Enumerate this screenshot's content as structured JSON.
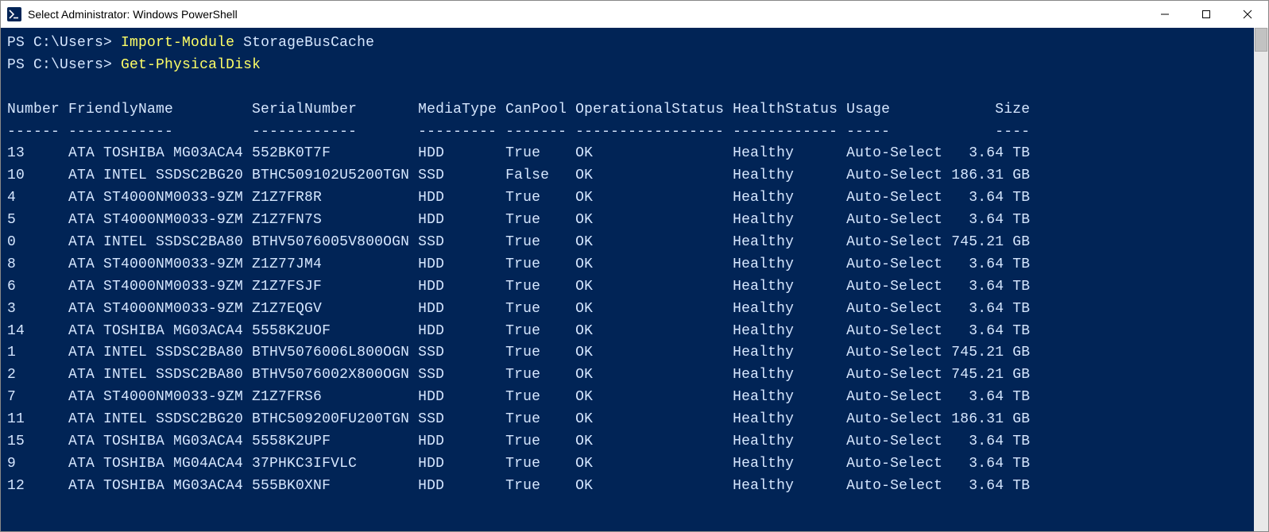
{
  "window": {
    "title": "Select Administrator: Windows PowerShell"
  },
  "terminal": {
    "prompt": "PS C:\\Users>",
    "commands": [
      {
        "cmd": "Import-Module",
        "arg": "StorageBusCache"
      },
      {
        "cmd": "Get-PhysicalDisk",
        "arg": ""
      }
    ],
    "headers": [
      "Number",
      "FriendlyName",
      "SerialNumber",
      "MediaType",
      "CanPool",
      "OperationalStatus",
      "HealthStatus",
      "Usage",
      "Size"
    ],
    "dashes": [
      "------",
      "------------",
      "------------",
      "---------",
      "-------",
      "-----------------",
      "------------",
      "-----",
      "----"
    ],
    "disks": [
      {
        "Number": "13",
        "FriendlyName": "ATA TOSHIBA MG03ACA4",
        "SerialNumber": "552BK0T7F",
        "MediaType": "HDD",
        "CanPool": "True",
        "OperationalStatus": "OK",
        "HealthStatus": "Healthy",
        "Usage": "Auto-Select",
        "Size": "3.64 TB"
      },
      {
        "Number": "10",
        "FriendlyName": "ATA INTEL SSDSC2BG20",
        "SerialNumber": "BTHC509102U5200TGN",
        "MediaType": "SSD",
        "CanPool": "False",
        "OperationalStatus": "OK",
        "HealthStatus": "Healthy",
        "Usage": "Auto-Select",
        "Size": "186.31 GB"
      },
      {
        "Number": "4",
        "FriendlyName": "ATA ST4000NM0033-9ZM",
        "SerialNumber": "Z1Z7FR8R",
        "MediaType": "HDD",
        "CanPool": "True",
        "OperationalStatus": "OK",
        "HealthStatus": "Healthy",
        "Usage": "Auto-Select",
        "Size": "3.64 TB"
      },
      {
        "Number": "5",
        "FriendlyName": "ATA ST4000NM0033-9ZM",
        "SerialNumber": "Z1Z7FN7S",
        "MediaType": "HDD",
        "CanPool": "True",
        "OperationalStatus": "OK",
        "HealthStatus": "Healthy",
        "Usage": "Auto-Select",
        "Size": "3.64 TB"
      },
      {
        "Number": "0",
        "FriendlyName": "ATA INTEL SSDSC2BA80",
        "SerialNumber": "BTHV5076005V800OGN",
        "MediaType": "SSD",
        "CanPool": "True",
        "OperationalStatus": "OK",
        "HealthStatus": "Healthy",
        "Usage": "Auto-Select",
        "Size": "745.21 GB"
      },
      {
        "Number": "8",
        "FriendlyName": "ATA ST4000NM0033-9ZM",
        "SerialNumber": "Z1Z77JM4",
        "MediaType": "HDD",
        "CanPool": "True",
        "OperationalStatus": "OK",
        "HealthStatus": "Healthy",
        "Usage": "Auto-Select",
        "Size": "3.64 TB"
      },
      {
        "Number": "6",
        "FriendlyName": "ATA ST4000NM0033-9ZM",
        "SerialNumber": "Z1Z7FSJF",
        "MediaType": "HDD",
        "CanPool": "True",
        "OperationalStatus": "OK",
        "HealthStatus": "Healthy",
        "Usage": "Auto-Select",
        "Size": "3.64 TB"
      },
      {
        "Number": "3",
        "FriendlyName": "ATA ST4000NM0033-9ZM",
        "SerialNumber": "Z1Z7EQGV",
        "MediaType": "HDD",
        "CanPool": "True",
        "OperationalStatus": "OK",
        "HealthStatus": "Healthy",
        "Usage": "Auto-Select",
        "Size": "3.64 TB"
      },
      {
        "Number": "14",
        "FriendlyName": "ATA TOSHIBA MG03ACA4",
        "SerialNumber": "5558K2UOF",
        "MediaType": "HDD",
        "CanPool": "True",
        "OperationalStatus": "OK",
        "HealthStatus": "Healthy",
        "Usage": "Auto-Select",
        "Size": "3.64 TB"
      },
      {
        "Number": "1",
        "FriendlyName": "ATA INTEL SSDSC2BA80",
        "SerialNumber": "BTHV5076006L800OGN",
        "MediaType": "SSD",
        "CanPool": "True",
        "OperationalStatus": "OK",
        "HealthStatus": "Healthy",
        "Usage": "Auto-Select",
        "Size": "745.21 GB"
      },
      {
        "Number": "2",
        "FriendlyName": "ATA INTEL SSDSC2BA80",
        "SerialNumber": "BTHV5076002X800OGN",
        "MediaType": "SSD",
        "CanPool": "True",
        "OperationalStatus": "OK",
        "HealthStatus": "Healthy",
        "Usage": "Auto-Select",
        "Size": "745.21 GB"
      },
      {
        "Number": "7",
        "FriendlyName": "ATA ST4000NM0033-9ZM",
        "SerialNumber": "Z1Z7FRS6",
        "MediaType": "HDD",
        "CanPool": "True",
        "OperationalStatus": "OK",
        "HealthStatus": "Healthy",
        "Usage": "Auto-Select",
        "Size": "3.64 TB"
      },
      {
        "Number": "11",
        "FriendlyName": "ATA INTEL SSDSC2BG20",
        "SerialNumber": "BTHC509200FU200TGN",
        "MediaType": "SSD",
        "CanPool": "True",
        "OperationalStatus": "OK",
        "HealthStatus": "Healthy",
        "Usage": "Auto-Select",
        "Size": "186.31 GB"
      },
      {
        "Number": "15",
        "FriendlyName": "ATA TOSHIBA MG03ACA4",
        "SerialNumber": "5558K2UPF",
        "MediaType": "HDD",
        "CanPool": "True",
        "OperationalStatus": "OK",
        "HealthStatus": "Healthy",
        "Usage": "Auto-Select",
        "Size": "3.64 TB"
      },
      {
        "Number": "9",
        "FriendlyName": "ATA TOSHIBA MG04ACA4",
        "SerialNumber": "37PHKC3IFVLC",
        "MediaType": "HDD",
        "CanPool": "True",
        "OperationalStatus": "OK",
        "HealthStatus": "Healthy",
        "Usage": "Auto-Select",
        "Size": "3.64 TB"
      },
      {
        "Number": "12",
        "FriendlyName": "ATA TOSHIBA MG03ACA4",
        "SerialNumber": "555BK0XNF",
        "MediaType": "HDD",
        "CanPool": "True",
        "OperationalStatus": "OK",
        "HealthStatus": "Healthy",
        "Usage": "Auto-Select",
        "Size": "3.64 TB"
      }
    ],
    "col_widths": {
      "Number": 7,
      "FriendlyName": 21,
      "SerialNumber": 19,
      "MediaType": 10,
      "CanPool": 8,
      "OperationalStatus": 18,
      "HealthStatus": 13,
      "Usage": 12,
      "Size": 9
    }
  }
}
